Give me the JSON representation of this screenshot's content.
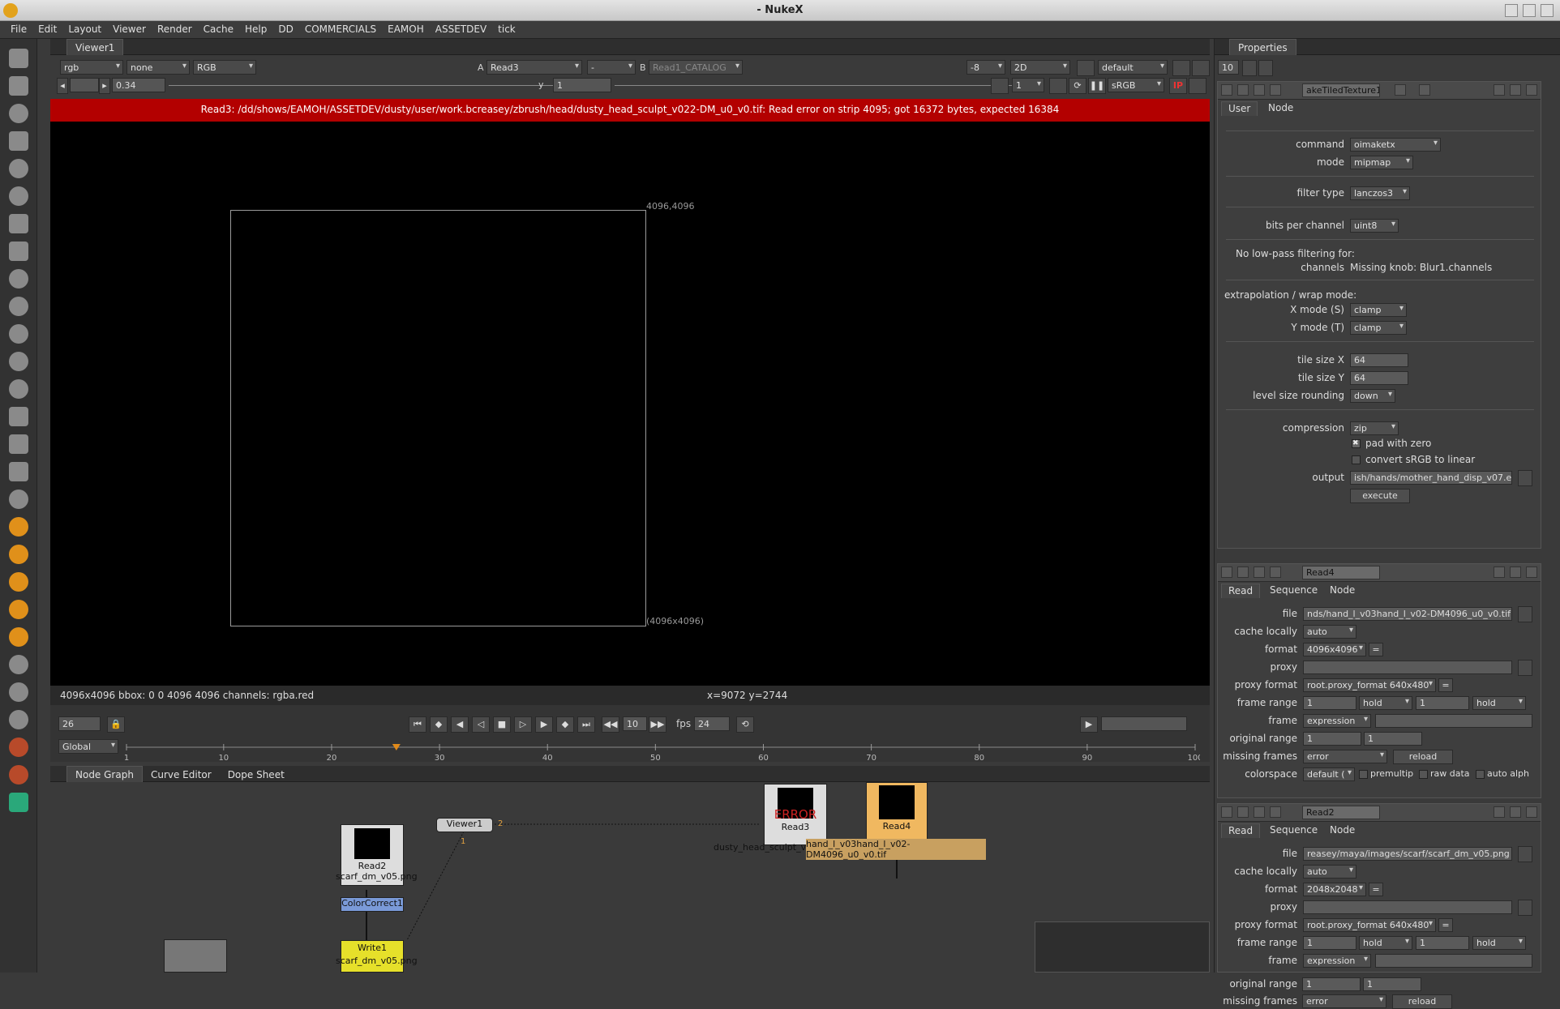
{
  "window": {
    "title": "- NukeX"
  },
  "menu": [
    "File",
    "Edit",
    "Layout",
    "Viewer",
    "Render",
    "Cache",
    "Help",
    "DD",
    "COMMERCIALS",
    "EAMOH",
    "ASSETDEV",
    "tick"
  ],
  "viewer": {
    "tab": "Viewer1",
    "channels": "rgb",
    "channel2": "none",
    "display_channels": "RGB",
    "a_label": "A",
    "a_input": "Read3",
    "b_op": "-",
    "b_label": "B",
    "b_input": "Read1_CATALOG",
    "gain": "0.34",
    "gamma_label": "y",
    "gamma": "1",
    "zoom": "-8",
    "mode": "2D",
    "lut": "default",
    "proxy": "1",
    "colorspace": "sRGB",
    "error": "Read3: /dd/shows/EAMOH/ASSETDEV/dusty/user/work.bcreasey/zbrush/head/dusty_head_sculpt_v022-DM_u0_v0.tif: Read error on strip 4095; got 16372 bytes, expected 16384",
    "corner_top": "4096,4096",
    "corner_bottom": "(4096x4096)",
    "info": "4096x4096 bbox: 0 0 4096 4096 channels: rgba.red",
    "coords": "x=9072 y=2744",
    "frame": "26",
    "step": "10",
    "fps_label": "fps",
    "fps": "24",
    "range_mode": "Global",
    "timeline": {
      "ticks": [
        "1",
        "10",
        "20",
        "30",
        "40",
        "50",
        "60",
        "70",
        "80",
        "90",
        "100"
      ],
      "current": "26",
      "end": "100"
    }
  },
  "nodegraph": {
    "tabs": [
      "Node Graph",
      "Curve Editor",
      "Dope Sheet"
    ],
    "nodes": {
      "viewer": "Viewer1",
      "viewer_in1": "1",
      "viewer_in2": "2",
      "read2": "Read2",
      "read2_file": "scarf_dm_v05.png",
      "cc": "ColorCorrect1",
      "write": "Write1",
      "write_file": "scarf_dm_v05.png",
      "read3": "Read3",
      "read3_err": "ERROR",
      "read3_file": "dusty_head_sculpt_v022-DM_u0_v0.tif",
      "read4": "Read4",
      "read4_file": "hand_l_v03hand_l_v02-DM4096_u0_v0.tif"
    }
  },
  "props": {
    "title": "Properties",
    "max": "10",
    "p1": {
      "name": "akeTiledTexture1",
      "tabs": [
        "User",
        "Node"
      ],
      "command_label": "command",
      "command": "oimaketx",
      "mode_label": "mode",
      "mode": "mipmap",
      "filter_label": "filter type",
      "filter": "lanczos3",
      "bits_label": "bits per channel",
      "bits": "uint8",
      "lowpass": "No low-pass filtering for:",
      "channels_label": "channels",
      "channels": "Missing knob: Blur1.channels",
      "wrap": "extrapolation / wrap mode:",
      "xmode_label": "X mode (S)",
      "xmode": "clamp",
      "ymode_label": "Y mode (T)",
      "ymode": "clamp",
      "tilex_label": "tile size X",
      "tilex": "64",
      "tiley_label": "tile size Y",
      "tiley": "64",
      "round_label": "level size rounding",
      "round": "down",
      "comp_label": "compression",
      "comp": "zip",
      "pad": "pad with zero",
      "srgb": "convert sRGB to linear",
      "output_label": "output",
      "output": "ish/hands/mother_hand_disp_v07.e",
      "execute": "execute"
    },
    "p2": {
      "name": "Read4",
      "tabs": [
        "Read",
        "Sequence",
        "Node"
      ],
      "file_label": "file",
      "file": "nds/hand_l_v03hand_l_v02-DM4096_u0_v0.tif",
      "cache_label": "cache locally",
      "cache": "auto",
      "format_label": "format",
      "format": "4096x4096",
      "proxy_label": "proxy",
      "pformat_label": "proxy format",
      "pformat": "root.proxy_format 640x480",
      "range_label": "frame range",
      "r1": "1",
      "r1mode": "hold",
      "r2": "1",
      "r2mode": "hold",
      "frame_label": "frame",
      "frame": "expression",
      "orig_label": "original range",
      "o1": "1",
      "o2": "1",
      "missing_label": "missing frames",
      "missing": "error",
      "reload": "reload",
      "cs_label": "colorspace",
      "cs": "default (",
      "premult": "premultip",
      "raw": "raw data",
      "autoa": "auto alph"
    },
    "p3": {
      "name": "Read2",
      "tabs": [
        "Read",
        "Sequence",
        "Node"
      ],
      "file_label": "file",
      "file": "reasey/maya/images/scarf/scarf_dm_v05.png",
      "cache_label": "cache locally",
      "cache": "auto",
      "format_label": "format",
      "format": "2048x2048",
      "proxy_label": "proxy",
      "pformat_label": "proxy format",
      "pformat": "root.proxy_format 640x480",
      "range_label": "frame range",
      "r1": "1",
      "r1mode": "hold",
      "r2": "1",
      "r2mode": "hold",
      "frame_label": "frame",
      "frame": "expression",
      "orig_label": "original range",
      "o1": "1",
      "o2": "1",
      "missing_label": "missing frames",
      "missing": "error",
      "reload": "reload"
    }
  }
}
